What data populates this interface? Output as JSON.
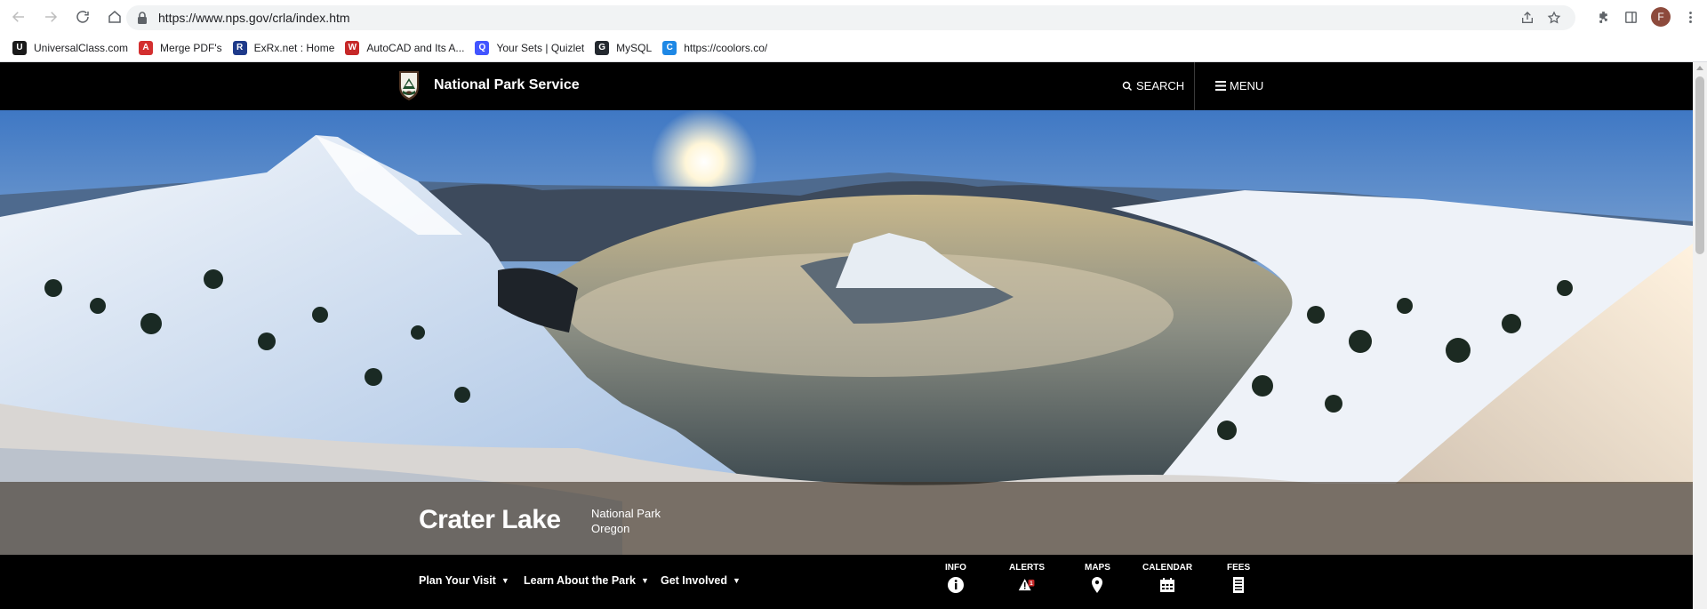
{
  "browser": {
    "url": "https://www.nps.gov/crla/index.htm",
    "avatar_letter": "F",
    "bookmarks": [
      {
        "label": "UniversalClass.com",
        "icon": "universalclass-icon",
        "color": "#1a1a1a",
        "glyph": "U"
      },
      {
        "label": "Merge PDF's",
        "icon": "pdf-icon",
        "color": "#d32f2f",
        "glyph": "A"
      },
      {
        "label": "ExRx.net : Home",
        "icon": "runner-icon",
        "color": "#1e3a8a",
        "glyph": "R"
      },
      {
        "label": "AutoCAD and Its A...",
        "icon": "chart-icon",
        "color": "#c62828",
        "glyph": "W"
      },
      {
        "label": "Your Sets | Quizlet",
        "icon": "quizlet-icon",
        "color": "#4255ff",
        "glyph": "Q"
      },
      {
        "label": "MySQL",
        "icon": "github-icon",
        "color": "#24292f",
        "glyph": "G"
      },
      {
        "label": "https://coolors.co/",
        "icon": "coolors-icon",
        "color": "#1e88e5",
        "glyph": "C"
      }
    ]
  },
  "header": {
    "site_title": "National Park Service",
    "search_label": "SEARCH",
    "menu_label": "MENU"
  },
  "hero": {
    "park_name": "Crater Lake",
    "park_type": "National Park",
    "park_state": "Oregon"
  },
  "park_nav": {
    "items": [
      "Plan Your Visit",
      "Learn About the Park",
      "Get Involved"
    ],
    "quick_links": {
      "info": "INFO",
      "alerts": "ALERTS",
      "alerts_count": "1",
      "maps": "MAPS",
      "calendar": "CALENDAR",
      "fees": "FEES"
    }
  },
  "colors": {
    "header_bg": "#000000",
    "alert_badge": "#c62828"
  }
}
